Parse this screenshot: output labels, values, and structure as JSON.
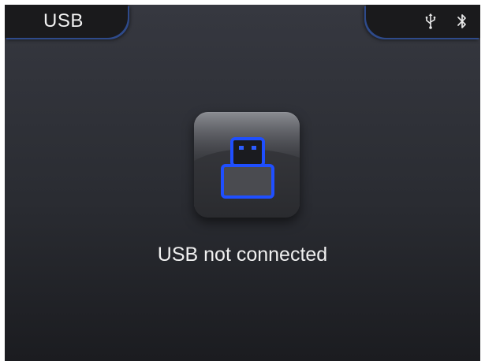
{
  "header": {
    "title": "USB",
    "status_icons": [
      "usb-icon",
      "bluetooth-icon"
    ]
  },
  "main": {
    "device_icon": "usb-drive-icon",
    "message": "USB not connected"
  },
  "colors": {
    "accent": "#1f4fff",
    "background": "#2c2e34",
    "text": "#f0f0f0"
  }
}
